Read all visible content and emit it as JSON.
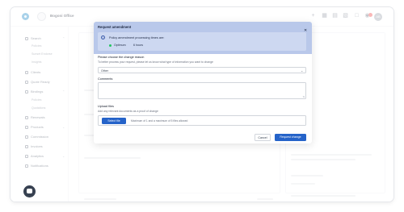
{
  "topbar": {
    "office_name": "Bogoni Office",
    "user_initials": "AB"
  },
  "sidebar": {
    "items": [
      {
        "label": "Search"
      },
      {
        "label": "Policies"
      },
      {
        "label": "Sunset Endorse"
      },
      {
        "label": "Insights"
      },
      {
        "label": "Clients"
      },
      {
        "label": "Quote Ready"
      },
      {
        "label": "Bindings"
      },
      {
        "label": "Policies"
      },
      {
        "label": "Quotations"
      },
      {
        "label": "Renewals"
      },
      {
        "label": "Products"
      },
      {
        "label": "Commission"
      },
      {
        "label": "Invoices"
      },
      {
        "label": "Analytics"
      },
      {
        "label": "Notifications"
      }
    ]
  },
  "modal": {
    "title": "Request amendment",
    "info": {
      "text": "Policy amendment processing times are:",
      "options": [
        {
          "label": "Optimum",
          "value": "6 hours",
          "color": "#22c55e"
        }
      ]
    },
    "reason": {
      "label": "Please choose the change reason",
      "help": "To better process your request, please let us know what type of information you want to change",
      "value": "Other"
    },
    "comments": {
      "label": "Comments"
    },
    "upload": {
      "label": "Upload files",
      "help": "Add any relevant documents as a proof of change",
      "button_label": "Select file",
      "note": "Maximum of 1 and a maximum of 5 files allowed"
    },
    "cancel_label": "Cancel",
    "submit_label": "Request change"
  },
  "colors": {
    "primary": "#2563c9",
    "modal_header": "#b9c8ea",
    "info_box": "#cdd8f1",
    "logo": "#1e88c9",
    "badge": "#ef4444"
  }
}
